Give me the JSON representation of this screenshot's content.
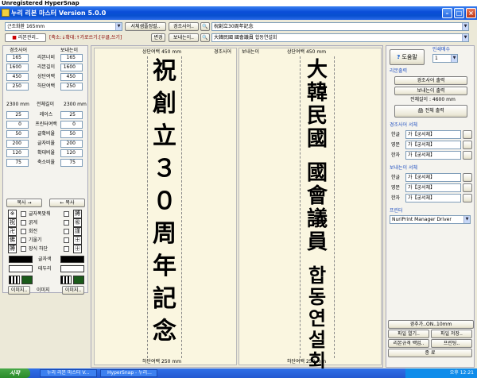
{
  "hypersnap": "Unregistered HyperSnap",
  "app_title": "누리 리본 마스터 Version 5.0.0",
  "toolbar": {
    "size_select": "근조화환 165mm",
    "sample_btn": "서체샘플정렬..",
    "condolence_label": "경조사어..",
    "condolence_value": "祝創立30周年記念",
    "ribbon_mgmt": "리본관리..",
    "hint": "[축소:↓확대:↑가로쓰기:[우클,쓰기]",
    "apply": "변경",
    "sender_label": "보내는이..",
    "sender_value": "大韓民國 國會議員 합동연설회"
  },
  "left": {
    "col1": "경조사어",
    "col2": "보내는이",
    "rows": [
      {
        "v1": "165",
        "lbl": "리본너비",
        "v2": "165"
      },
      {
        "v1": "1600",
        "lbl": "리본길이",
        "v2": "1600"
      },
      {
        "v1": "450",
        "lbl": "상단여백",
        "v2": "450"
      },
      {
        "v1": "250",
        "lbl": "하단여백",
        "v2": "250"
      }
    ],
    "total_left": "2300 mm",
    "total_lbl": "전체길이",
    "total_right": "2300 mm",
    "rows2": [
      {
        "v1": "25",
        "lbl": "레이스",
        "v2": "25"
      },
      {
        "v1": "0",
        "lbl": "프린터여백",
        "v2": "0"
      },
      {
        "v1": "50",
        "lbl": "글확비율",
        "v2": "50"
      },
      {
        "v1": "200",
        "lbl": "글자비율",
        "v2": "200"
      },
      {
        "v1": "120",
        "lbl": "확대비율",
        "v2": "120"
      },
      {
        "v1": "75",
        "lbl": "축소비율",
        "v2": "75"
      }
    ],
    "copy_left": "복사 →",
    "copy_right": "← 복사",
    "opts": [
      "글자폭맞춰",
      "굵게",
      "회전",
      "기울기",
      "장식 하단"
    ],
    "syms": [
      "※",
      "祝",
      "卍",
      "佛",
      "賻",
      "㊗",
      "謹",
      "㊉"
    ],
    "color_lbl": "글자색",
    "border_lbl": "테두리",
    "img_left": "이미지..",
    "img_mid": "이미지",
    "img_right": "이미지.."
  },
  "center": {
    "left_top": "상단여백 450 mm",
    "left_name": "경조사어",
    "right_name": "보내는이",
    "right_top": "상단여백 450 mm",
    "left_chars": [
      "祝",
      "創",
      "立",
      "３",
      "０",
      "周",
      "年",
      "記",
      "念"
    ],
    "right_top_chars": [
      "大",
      "韓",
      "民",
      "國"
    ],
    "right_mid_chars": [
      "國",
      "會",
      "議",
      "員"
    ],
    "right_low_chars": [
      "합",
      "동",
      "연",
      "설",
      "회"
    ],
    "left_bottom": "하단여백 250 mm",
    "right_bottom": "하단여백 250 mm"
  },
  "right": {
    "help": "도움말",
    "copies_lbl": "인쇄매수",
    "copies": "1",
    "ribbon_print": "리본출력",
    "print_cond": "경조사어 출력",
    "print_send": "보내는이 출력",
    "total_len": "전체길이 : 4600 mm",
    "print_all": "전체 출력",
    "cond_font_title": "경조사어 서체",
    "send_font_title": "보내는이 서체",
    "font_rows": [
      {
        "lbl": "한글",
        "val": "가【궁서체】"
      },
      {
        "lbl": "영문",
        "val": "가【궁서체】"
      },
      {
        "lbl": "한자",
        "val": "가【궁서체】"
      }
    ],
    "printer_title": "프린터",
    "printer": "NuriPrint Manager Driver",
    "set_top": "경추가..ON..10mm",
    "file_open": "파일 열기..",
    "file_save": "파일 저장..",
    "backup": "리본규격 백업..",
    "restore": "프린팅..",
    "exit": "종 료"
  },
  "taskbar": {
    "start": "시작",
    "item1": "누리 리본 마스터 V...",
    "item2": "HyperSnap - 누리...",
    "clock": "오후 12:21"
  }
}
